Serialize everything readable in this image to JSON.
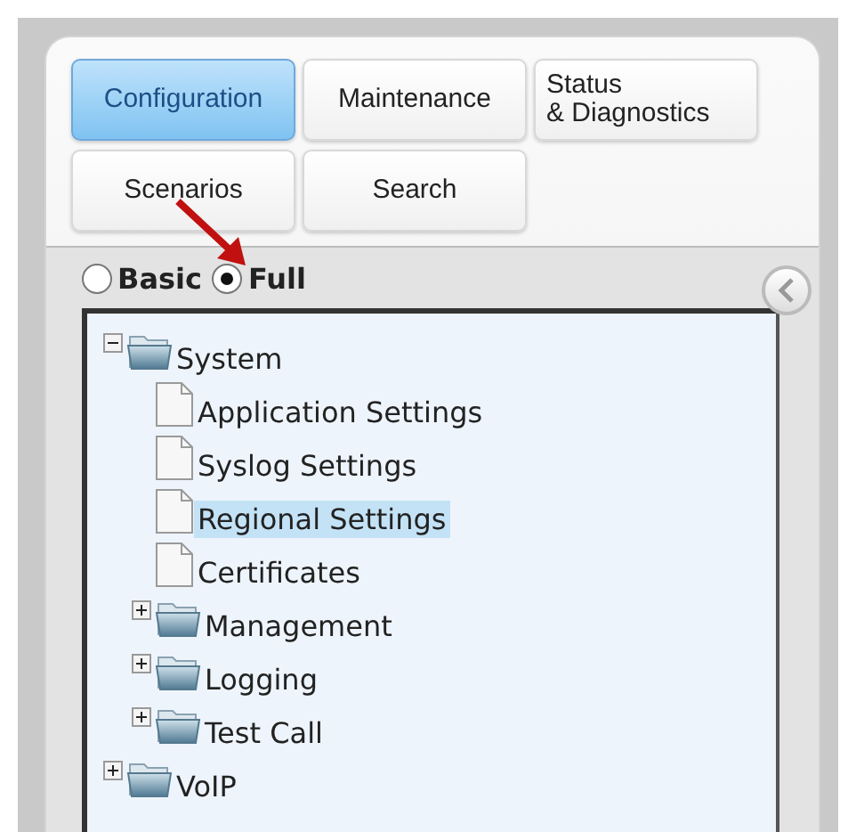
{
  "nav_buttons": [
    {
      "label": "Configuration",
      "selected": true
    },
    {
      "label": "Maintenance",
      "selected": false
    },
    {
      "label": "Status\n& Diagnostics",
      "selected": false
    },
    {
      "label": "Scenarios",
      "selected": false
    },
    {
      "label": "Search",
      "selected": false
    }
  ],
  "view_mode": [
    {
      "label": "Basic",
      "selected": false
    },
    {
      "label": "Full",
      "selected": true
    }
  ],
  "tree": [
    {
      "label": "System",
      "kind": "folder",
      "expanded": true,
      "selected": false,
      "children": [
        {
          "label": "Application Settings",
          "kind": "page",
          "selected": false
        },
        {
          "label": "Syslog Settings",
          "kind": "page",
          "selected": false
        },
        {
          "label": "Regional Settings",
          "kind": "page",
          "selected": true
        },
        {
          "label": "Certificates",
          "kind": "page",
          "selected": false
        },
        {
          "label": "Management",
          "kind": "folder",
          "expanded": false,
          "selected": false
        },
        {
          "label": "Logging",
          "kind": "folder",
          "expanded": false,
          "selected": false
        },
        {
          "label": "Test Call",
          "kind": "folder",
          "expanded": false,
          "selected": false
        }
      ]
    },
    {
      "label": "VoIP",
      "kind": "folder",
      "expanded": false,
      "selected": false
    }
  ]
}
